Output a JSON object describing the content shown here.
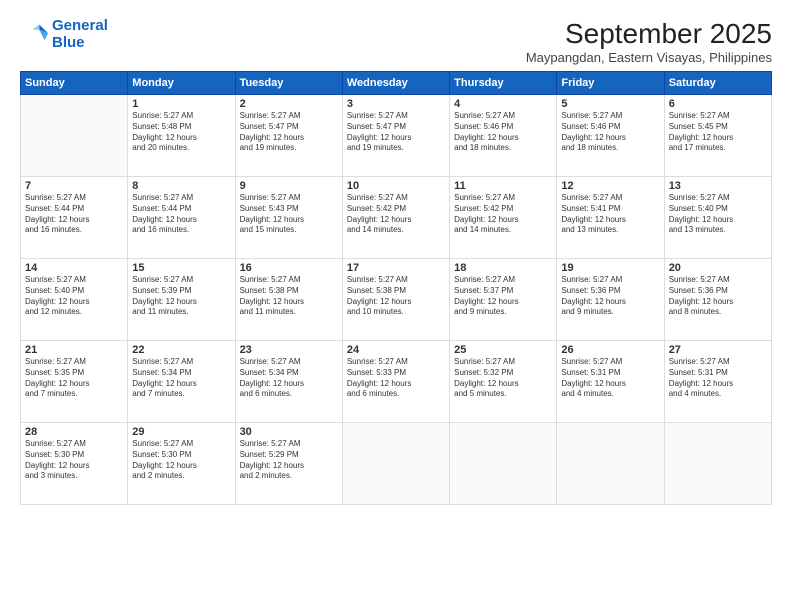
{
  "header": {
    "logo_line1": "General",
    "logo_line2": "Blue",
    "month_year": "September 2025",
    "location": "Maypangdan, Eastern Visayas, Philippines"
  },
  "days_of_week": [
    "Sunday",
    "Monday",
    "Tuesday",
    "Wednesday",
    "Thursday",
    "Friday",
    "Saturday"
  ],
  "weeks": [
    [
      {
        "num": "",
        "lines": []
      },
      {
        "num": "1",
        "lines": [
          "Sunrise: 5:27 AM",
          "Sunset: 5:48 PM",
          "Daylight: 12 hours",
          "and 20 minutes."
        ]
      },
      {
        "num": "2",
        "lines": [
          "Sunrise: 5:27 AM",
          "Sunset: 5:47 PM",
          "Daylight: 12 hours",
          "and 19 minutes."
        ]
      },
      {
        "num": "3",
        "lines": [
          "Sunrise: 5:27 AM",
          "Sunset: 5:47 PM",
          "Daylight: 12 hours",
          "and 19 minutes."
        ]
      },
      {
        "num": "4",
        "lines": [
          "Sunrise: 5:27 AM",
          "Sunset: 5:46 PM",
          "Daylight: 12 hours",
          "and 18 minutes."
        ]
      },
      {
        "num": "5",
        "lines": [
          "Sunrise: 5:27 AM",
          "Sunset: 5:46 PM",
          "Daylight: 12 hours",
          "and 18 minutes."
        ]
      },
      {
        "num": "6",
        "lines": [
          "Sunrise: 5:27 AM",
          "Sunset: 5:45 PM",
          "Daylight: 12 hours",
          "and 17 minutes."
        ]
      }
    ],
    [
      {
        "num": "7",
        "lines": [
          "Sunrise: 5:27 AM",
          "Sunset: 5:44 PM",
          "Daylight: 12 hours",
          "and 16 minutes."
        ]
      },
      {
        "num": "8",
        "lines": [
          "Sunrise: 5:27 AM",
          "Sunset: 5:44 PM",
          "Daylight: 12 hours",
          "and 16 minutes."
        ]
      },
      {
        "num": "9",
        "lines": [
          "Sunrise: 5:27 AM",
          "Sunset: 5:43 PM",
          "Daylight: 12 hours",
          "and 15 minutes."
        ]
      },
      {
        "num": "10",
        "lines": [
          "Sunrise: 5:27 AM",
          "Sunset: 5:42 PM",
          "Daylight: 12 hours",
          "and 14 minutes."
        ]
      },
      {
        "num": "11",
        "lines": [
          "Sunrise: 5:27 AM",
          "Sunset: 5:42 PM",
          "Daylight: 12 hours",
          "and 14 minutes."
        ]
      },
      {
        "num": "12",
        "lines": [
          "Sunrise: 5:27 AM",
          "Sunset: 5:41 PM",
          "Daylight: 12 hours",
          "and 13 minutes."
        ]
      },
      {
        "num": "13",
        "lines": [
          "Sunrise: 5:27 AM",
          "Sunset: 5:40 PM",
          "Daylight: 12 hours",
          "and 13 minutes."
        ]
      }
    ],
    [
      {
        "num": "14",
        "lines": [
          "Sunrise: 5:27 AM",
          "Sunset: 5:40 PM",
          "Daylight: 12 hours",
          "and 12 minutes."
        ]
      },
      {
        "num": "15",
        "lines": [
          "Sunrise: 5:27 AM",
          "Sunset: 5:39 PM",
          "Daylight: 12 hours",
          "and 11 minutes."
        ]
      },
      {
        "num": "16",
        "lines": [
          "Sunrise: 5:27 AM",
          "Sunset: 5:38 PM",
          "Daylight: 12 hours",
          "and 11 minutes."
        ]
      },
      {
        "num": "17",
        "lines": [
          "Sunrise: 5:27 AM",
          "Sunset: 5:38 PM",
          "Daylight: 12 hours",
          "and 10 minutes."
        ]
      },
      {
        "num": "18",
        "lines": [
          "Sunrise: 5:27 AM",
          "Sunset: 5:37 PM",
          "Daylight: 12 hours",
          "and 9 minutes."
        ]
      },
      {
        "num": "19",
        "lines": [
          "Sunrise: 5:27 AM",
          "Sunset: 5:36 PM",
          "Daylight: 12 hours",
          "and 9 minutes."
        ]
      },
      {
        "num": "20",
        "lines": [
          "Sunrise: 5:27 AM",
          "Sunset: 5:36 PM",
          "Daylight: 12 hours",
          "and 8 minutes."
        ]
      }
    ],
    [
      {
        "num": "21",
        "lines": [
          "Sunrise: 5:27 AM",
          "Sunset: 5:35 PM",
          "Daylight: 12 hours",
          "and 7 minutes."
        ]
      },
      {
        "num": "22",
        "lines": [
          "Sunrise: 5:27 AM",
          "Sunset: 5:34 PM",
          "Daylight: 12 hours",
          "and 7 minutes."
        ]
      },
      {
        "num": "23",
        "lines": [
          "Sunrise: 5:27 AM",
          "Sunset: 5:34 PM",
          "Daylight: 12 hours",
          "and 6 minutes."
        ]
      },
      {
        "num": "24",
        "lines": [
          "Sunrise: 5:27 AM",
          "Sunset: 5:33 PM",
          "Daylight: 12 hours",
          "and 6 minutes."
        ]
      },
      {
        "num": "25",
        "lines": [
          "Sunrise: 5:27 AM",
          "Sunset: 5:32 PM",
          "Daylight: 12 hours",
          "and 5 minutes."
        ]
      },
      {
        "num": "26",
        "lines": [
          "Sunrise: 5:27 AM",
          "Sunset: 5:31 PM",
          "Daylight: 12 hours",
          "and 4 minutes."
        ]
      },
      {
        "num": "27",
        "lines": [
          "Sunrise: 5:27 AM",
          "Sunset: 5:31 PM",
          "Daylight: 12 hours",
          "and 4 minutes."
        ]
      }
    ],
    [
      {
        "num": "28",
        "lines": [
          "Sunrise: 5:27 AM",
          "Sunset: 5:30 PM",
          "Daylight: 12 hours",
          "and 3 minutes."
        ]
      },
      {
        "num": "29",
        "lines": [
          "Sunrise: 5:27 AM",
          "Sunset: 5:30 PM",
          "Daylight: 12 hours",
          "and 2 minutes."
        ]
      },
      {
        "num": "30",
        "lines": [
          "Sunrise: 5:27 AM",
          "Sunset: 5:29 PM",
          "Daylight: 12 hours",
          "and 2 minutes."
        ]
      },
      {
        "num": "",
        "lines": []
      },
      {
        "num": "",
        "lines": []
      },
      {
        "num": "",
        "lines": []
      },
      {
        "num": "",
        "lines": []
      }
    ]
  ]
}
